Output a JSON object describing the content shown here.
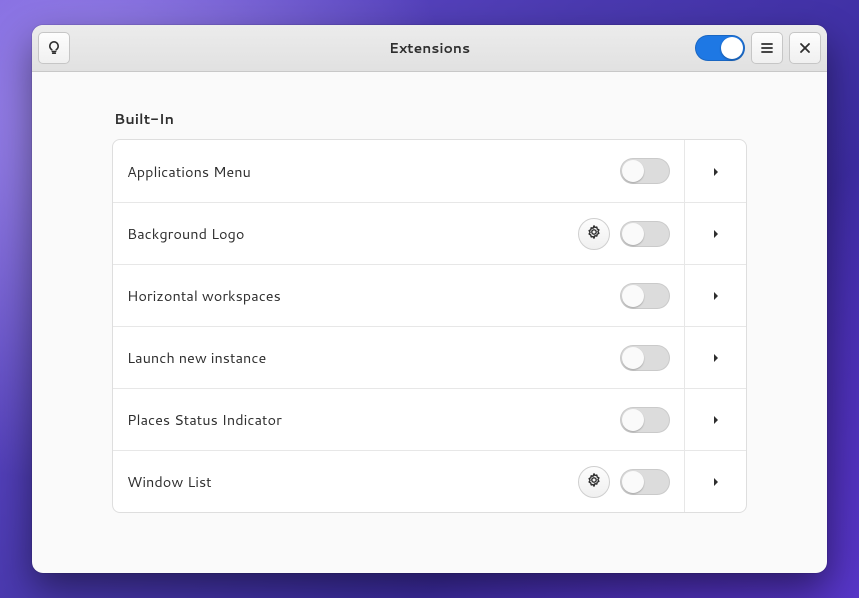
{
  "header": {
    "title": "Extensions",
    "global_enabled": true
  },
  "section": {
    "title": "Built-In"
  },
  "extensions": [
    {
      "name": "Applications Menu",
      "enabled": false,
      "has_prefs": false
    },
    {
      "name": "Background Logo",
      "enabled": false,
      "has_prefs": true
    },
    {
      "name": "Horizontal workspaces",
      "enabled": false,
      "has_prefs": false
    },
    {
      "name": "Launch new instance",
      "enabled": false,
      "has_prefs": false
    },
    {
      "name": "Places Status Indicator",
      "enabled": false,
      "has_prefs": false
    },
    {
      "name": "Window List",
      "enabled": false,
      "has_prefs": true
    }
  ],
  "colors": {
    "accent": "#1e78e4",
    "switch_off": "#dcdcdc"
  }
}
